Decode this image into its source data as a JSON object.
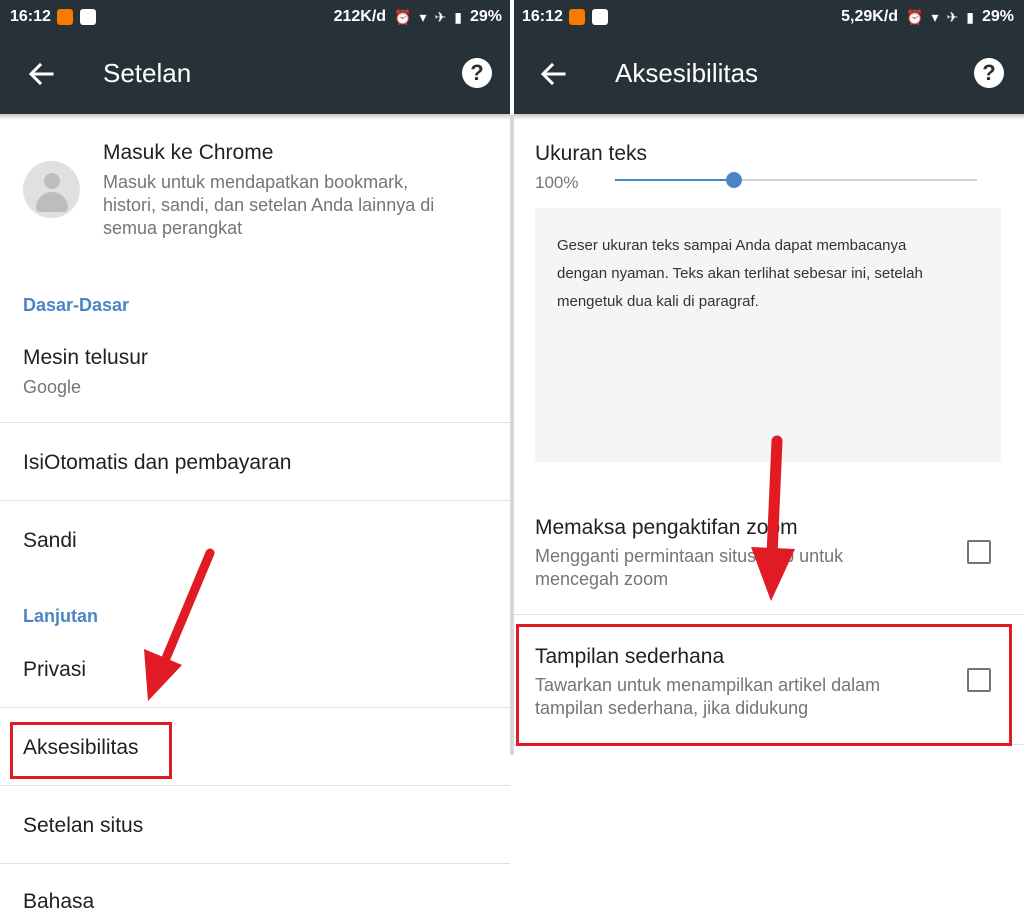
{
  "left": {
    "status": {
      "time": "16:12",
      "speed": "212K/d",
      "battery": "29%"
    },
    "appbar": {
      "title": "Setelan",
      "help_icon": "?"
    },
    "account": {
      "title": "Masuk ke Chrome",
      "subtitle": "Masuk untuk mendapatkan bookmark histori, sandi, dan setelan Anda lainnya di semua perangkat",
      "subtitle_lines": [
        "Masuk untuk mendapatkan bookmark,",
        "histori, sandi, dan setelan Anda lainnya di",
        "semua perangkat"
      ]
    },
    "section_basics": "Dasar-Dasar",
    "search_engine": {
      "title": "Mesin telusur",
      "value": "Google"
    },
    "autofill": "IsiOtomatis dan pembayaran",
    "passwords": "Sandi",
    "section_advanced": "Lanjutan",
    "privacy": "Privasi",
    "accessibility": "Aksesibilitas",
    "site_settings": "Setelan situs",
    "languages": "Bahasa"
  },
  "right": {
    "status": {
      "time": "16:12",
      "speed": "5,29K/d",
      "battery": "29%"
    },
    "appbar": {
      "title": "Aksesibilitas",
      "help_icon": "?"
    },
    "text_size": {
      "label": "Ukuran teks",
      "value": "100%",
      "slider_fraction": 0.33,
      "preview_lines": [
        "Geser ukuran teks sampai Anda dapat membacanya",
        "dengan nyaman. Teks akan terlihat sebesar ini, setelah",
        "mengetuk dua kali di paragraf."
      ]
    },
    "force_zoom": {
      "title": "Memaksa pengaktifan zoom",
      "subtitle_lines": [
        "Mengganti permintaan situs web untuk",
        "mencegah zoom"
      ],
      "checked": false
    },
    "simplified_view": {
      "title": "Tampilan sederhana",
      "subtitle_lines": [
        "Tawarkan untuk menampilkan artikel dalam",
        "tampilan sederhana, jika didukung"
      ],
      "checked": false
    }
  },
  "colors": {
    "toolbar": "#263238",
    "accent": "#4a86c6",
    "highlight": "#e01b24"
  }
}
